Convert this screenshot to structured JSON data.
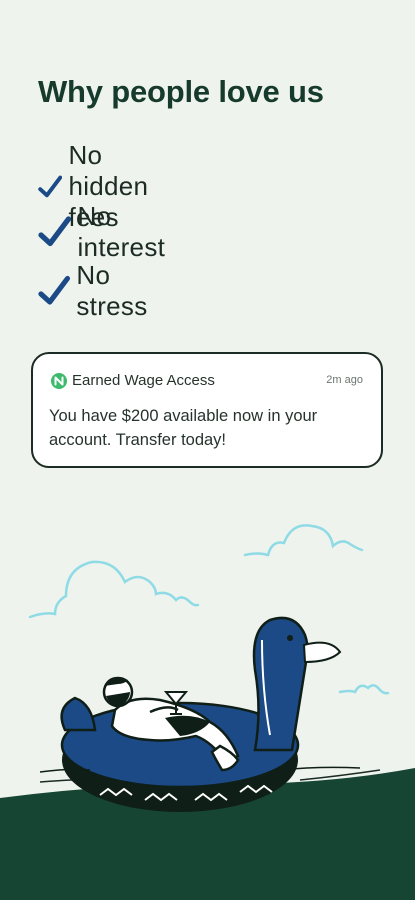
{
  "heading": "Why people love us",
  "benefits": [
    {
      "label": "No hidden fees",
      "icon": "checkmark-icon"
    },
    {
      "label": "No interest",
      "icon": "checkmark-icon"
    },
    {
      "label": "No stress",
      "icon": "checkmark-icon"
    }
  ],
  "notification": {
    "app_name": "Earned Wage Access",
    "time": "2m ago",
    "message": "You have $200 available now in your account. Transfer today!",
    "logo_icon": "app-logo-icon"
  },
  "colors": {
    "background": "#eef3ee",
    "heading": "#163a2c",
    "check": "#1b4a86",
    "ground": "#164534",
    "cloud": "#8fdbe5",
    "duck": "#1b4a86"
  }
}
